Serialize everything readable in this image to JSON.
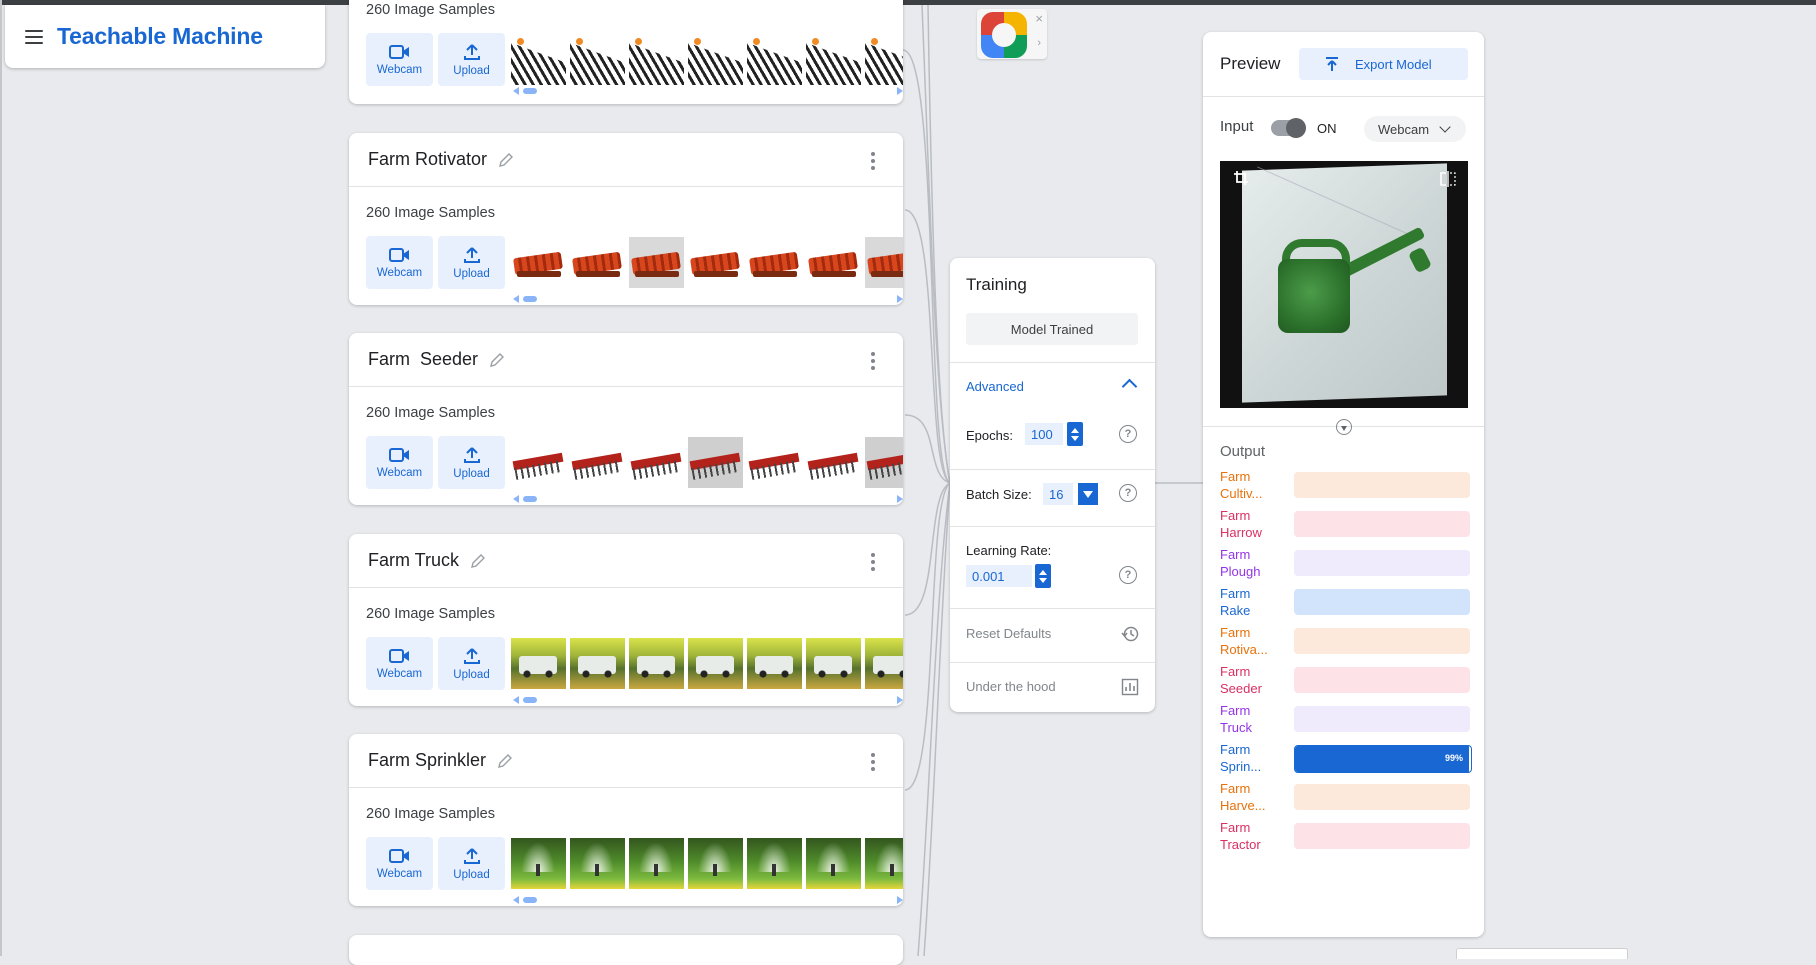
{
  "app": {
    "title": "Teachable Machine"
  },
  "classes": [
    {
      "name": "",
      "samples": "260 Image Samples",
      "webcam": "Webcam",
      "upload": "Upload"
    },
    {
      "name": "Farm Rotivator",
      "samples": "260 Image Samples",
      "webcam": "Webcam",
      "upload": "Upload"
    },
    {
      "name": "Farm  Seeder",
      "samples": "260 Image Samples",
      "webcam": "Webcam",
      "upload": "Upload"
    },
    {
      "name": "Farm Truck",
      "samples": "260 Image Samples",
      "webcam": "Webcam",
      "upload": "Upload"
    },
    {
      "name": "Farm Sprinkler",
      "samples": "260 Image Samples",
      "webcam": "Webcam",
      "upload": "Upload"
    }
  ],
  "training": {
    "title": "Training",
    "status_button": "Model Trained",
    "advanced_label": "Advanced",
    "epochs_label": "Epochs:",
    "epochs_value": "100",
    "batch_label": "Batch Size:",
    "batch_value": "16",
    "lr_label": "Learning Rate:",
    "lr_value": "0.001",
    "reset_label": "Reset Defaults",
    "hood_label": "Under the hood",
    "help_glyph": "?"
  },
  "preview": {
    "title": "Preview",
    "export_label": "Export Model",
    "input_label": "Input",
    "toggle_state": "ON",
    "source_select": "Webcam",
    "output_label": "Output",
    "outputs": [
      {
        "name": "Farm\nCultiv...",
        "color": "#e8710a",
        "track": "#fde9dc",
        "confidence": 0
      },
      {
        "name": "Farm\nHarrow",
        "color": "#d93064",
        "track": "#fde3e8",
        "confidence": 0
      },
      {
        "name": "Farm\nPlough",
        "color": "#9334e6",
        "track": "#efeafc",
        "confidence": 0
      },
      {
        "name": "Farm\nRake",
        "color": "#1967d2",
        "track": "#d2e3fc",
        "confidence": 0
      },
      {
        "name": "Farm\nRotiva...",
        "color": "#e8710a",
        "track": "#fde9dc",
        "confidence": 0
      },
      {
        "name": "Farm\nSeeder",
        "color": "#d93064",
        "track": "#fde3e8",
        "confidence": 0
      },
      {
        "name": "Farm\nTruck",
        "color": "#9334e6",
        "track": "#efeafc",
        "confidence": 0
      },
      {
        "name": "Farm\nSprin...",
        "color": "#1967d2",
        "track": "#1967d2",
        "confidence": 0.99,
        "pct_label": "99%"
      },
      {
        "name": "Farm\nHarve...",
        "color": "#e8710a",
        "track": "#fde9dc",
        "confidence": 0
      },
      {
        "name": "Farm\nTractor",
        "color": "#d93064",
        "track": "#fde3e8",
        "confidence": 0
      }
    ]
  },
  "extension": {
    "close_glyph": "×",
    "arrow_glyph": "›"
  }
}
